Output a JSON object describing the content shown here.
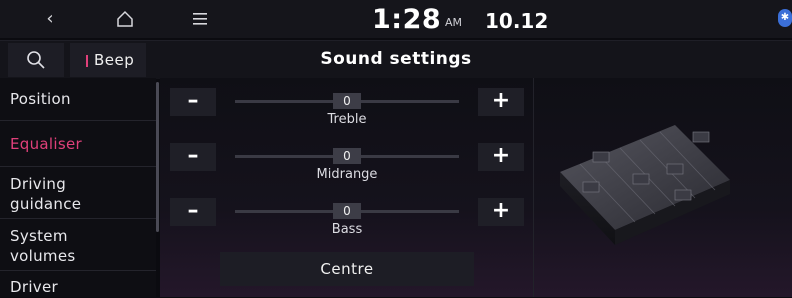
{
  "status": {
    "time": "1:28",
    "ampm": "AM",
    "date": "10.12",
    "icons": [
      "back-icon",
      "home-icon",
      "menu-icon",
      "bluetooth-icon"
    ]
  },
  "header": {
    "title": "Sound settings",
    "beep_label": "Beep"
  },
  "sidebar": {
    "items": [
      {
        "label": "Position"
      },
      {
        "label": "Equaliser"
      },
      {
        "label": "Driving\nguidance"
      },
      {
        "label": "System\nvolumes"
      },
      {
        "label": "Driver"
      }
    ]
  },
  "equaliser": {
    "treble": {
      "label": "Treble",
      "value": "0"
    },
    "midrange": {
      "label": "Midrange",
      "value": "0"
    },
    "bass": {
      "label": "Bass",
      "value": "0"
    },
    "centre_label": "Centre"
  },
  "colors": {
    "accent": "#e0407a",
    "background": "#0b0b10",
    "panel": "#1d1d25"
  }
}
